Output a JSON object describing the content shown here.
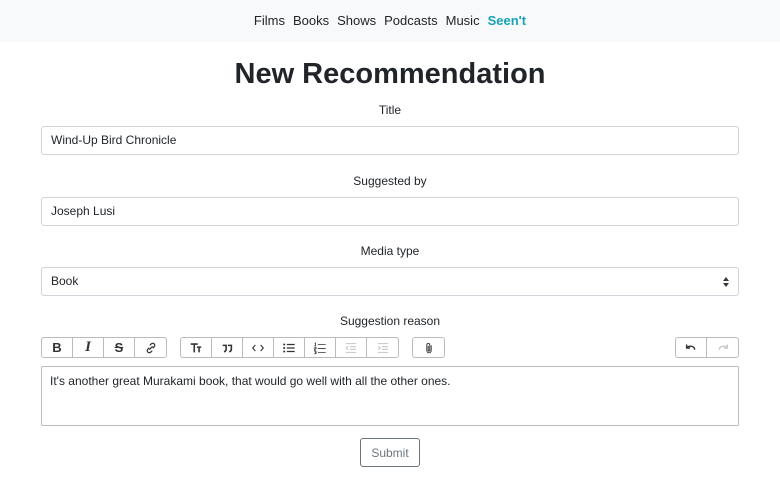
{
  "nav": {
    "items": [
      {
        "label": "Films"
      },
      {
        "label": "Books"
      },
      {
        "label": "Shows"
      },
      {
        "label": "Podcasts"
      },
      {
        "label": "Music"
      }
    ],
    "brand": "Seen't",
    "brand_color": "#17a2b8"
  },
  "page": {
    "title": "New Recommendation"
  },
  "form": {
    "title_label": "Title",
    "title_value": "Wind-Up Bird Chronicle",
    "suggested_by_label": "Suggested by",
    "suggested_by_value": "Joseph Lusi",
    "media_type_label": "Media type",
    "media_type_value": "Book",
    "reason_label": "Suggestion reason",
    "reason_value": "It's another great Murakami book, that would go well with all the other ones.",
    "submit_label": "Submit"
  },
  "toolbar": {
    "groups": [
      [
        "bold-icon",
        "italic-icon",
        "strikethrough-icon",
        "link-icon"
      ],
      [
        "heading-icon",
        "quote-icon",
        "code-icon",
        "bullet-list-icon",
        "numbered-list-icon",
        "decrease-indent-icon",
        "increase-indent-icon"
      ],
      [
        "attach-files-icon"
      ],
      [
        "undo-icon",
        "redo-icon"
      ]
    ],
    "disabled": [
      "decrease-indent-icon",
      "increase-indent-icon",
      "redo-icon"
    ]
  }
}
